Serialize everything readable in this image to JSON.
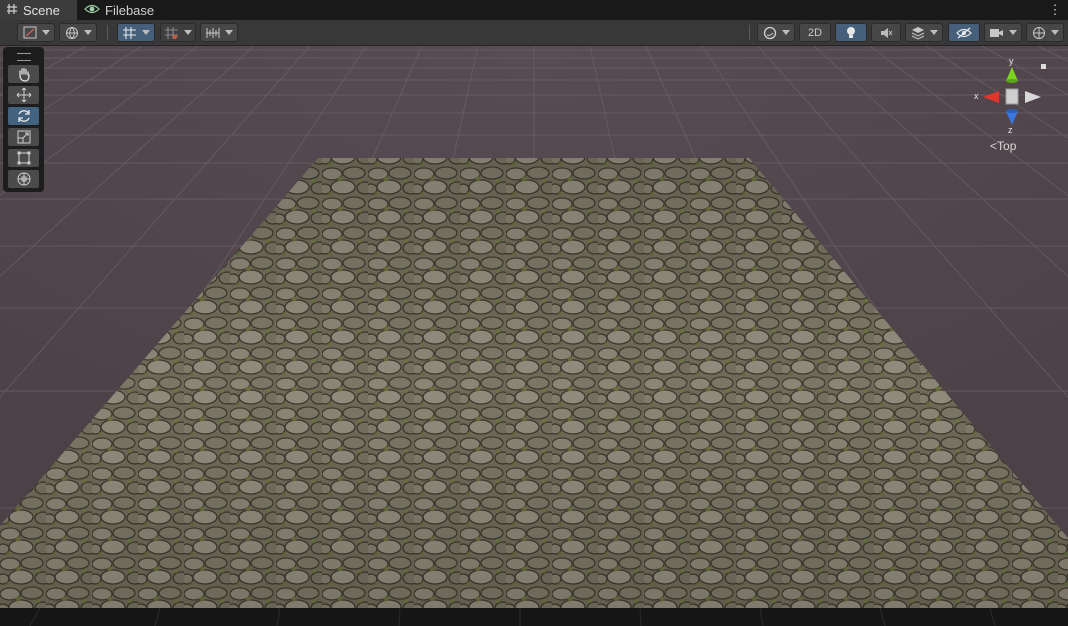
{
  "tabs": [
    {
      "label": "Scene",
      "icon": "grid-hash-icon",
      "active": true
    },
    {
      "label": "Filebase",
      "icon": "eye-icon",
      "active": false
    }
  ],
  "toolbar": {
    "mode_2d_label": "2D",
    "accent_color": "#46607c"
  },
  "tools": [
    "hand-tool-icon",
    "move-tool-icon",
    "rotate-tool-icon",
    "scale-tool-icon",
    "rect-tool-icon",
    "transform-tool-icon"
  ],
  "active_tool": "rotate-tool-icon",
  "gizmo": {
    "x_label": "x",
    "y_label": "y",
    "z_label": "z",
    "view_label": "Top",
    "view_prefix": "<"
  }
}
